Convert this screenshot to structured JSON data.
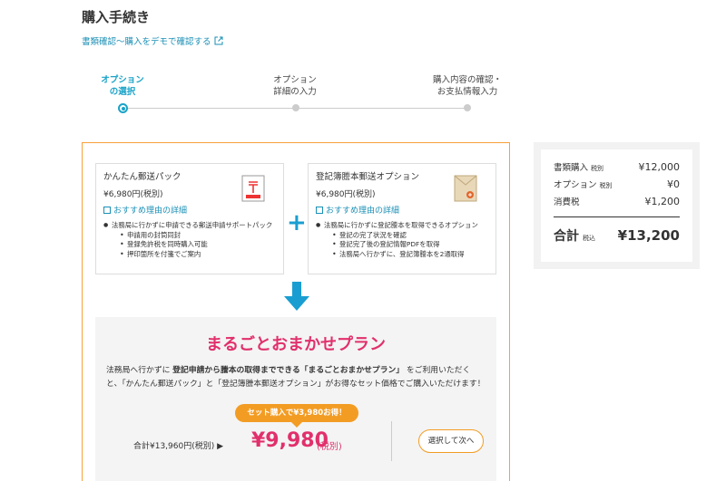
{
  "header": {
    "title": "購入手続き",
    "demo_link": "書類確認～購入をデモで確認する"
  },
  "stepper": {
    "steps": [
      {
        "line1": "オプション",
        "line2": "の選択"
      },
      {
        "line1": "オプション",
        "line2": "詳細の入力"
      },
      {
        "line1": "購入内容の確認・",
        "line2": "お支払情報入力"
      }
    ],
    "active_index": 0
  },
  "options": [
    {
      "title": "かんたん郵送パック",
      "price": "¥6,980円(税別)",
      "link": "おすすめ理由の詳細",
      "main_point": "法務局に行かずに申請できる郵送申請サポートパック",
      "sub_points": [
        "申請用の封筒同封",
        "登録免許税を同時購入可能",
        "押印箇所を付箋でご案内"
      ],
      "icon": "postal-envelope-icon"
    },
    {
      "title": "登記簿謄本郵送オプション",
      "price": "¥6,980円(税別)",
      "link": "おすすめ理由の詳細",
      "main_point": "法務局に行かずに登記謄本を取得できるオプション",
      "sub_points": [
        "登記の完了状況を確認",
        "登記完了後の登記情報PDFを取得",
        "法務局へ行かずに、登記簿謄本を2通取得"
      ],
      "icon": "envelope-seal-icon"
    }
  ],
  "plan": {
    "title": "まるごとおまかせプラン",
    "desc_prefix": "法務局へ行かずに ",
    "desc_bold1": "登記申請から謄本の取得までできる「まるごとおまかせプラン」",
    "desc_rest": " をご利用いただくと、「かんたん郵送パック」と「登記簿謄本郵送オプション」がお得なセット価格でご購入いただけます！",
    "badge": "セット購入で¥3,980お得！",
    "original_price": "合計¥13,960円(税別) ▶",
    "sale_price": "¥9,980",
    "sale_tax": "(税別)",
    "next_button": "選択して次へ"
  },
  "summary": {
    "rows": [
      {
        "label": "書類購入",
        "note": "税別",
        "value": "¥12,000"
      },
      {
        "label": "オプション",
        "note": "税別",
        "value": "¥0"
      },
      {
        "label": "消費税",
        "note": "",
        "value": "¥1,200"
      }
    ],
    "total_label": "合計",
    "total_note": "税込",
    "total_value": "¥13,200"
  },
  "colors": {
    "accent_blue": "#1aa3c8",
    "link_blue": "#1a8fb5",
    "orange": "#f39c24",
    "pink": "#e1306c"
  }
}
